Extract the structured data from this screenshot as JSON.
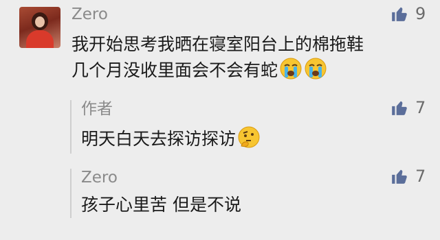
{
  "comment": {
    "username": "Zero",
    "line1": "我开始思考我晒在寝室阳台上的棉拖鞋",
    "line2": "几个月没收里面会不会有蛇",
    "line2_emojis": [
      "crying-emoji",
      "crying-emoji"
    ],
    "likes": "9"
  },
  "replies": [
    {
      "username": "作者",
      "text": "明天白天去探访探访",
      "emoji": "thinking-emoji",
      "likes": "7"
    },
    {
      "username": "Zero",
      "text": "孩子心里苦 但是不说",
      "likes": "7"
    }
  ],
  "colors": {
    "background": "#ededed",
    "username": "#8a8a8a",
    "text": "#1a1a1a",
    "like_icon": "#5b6e9a",
    "reply_bar": "#cfcfcf"
  }
}
